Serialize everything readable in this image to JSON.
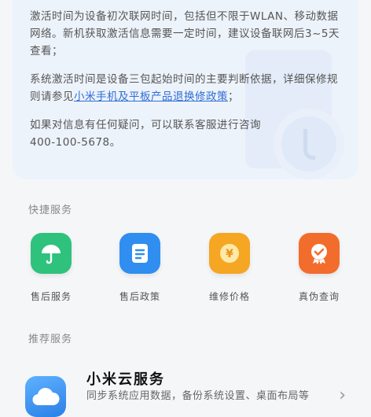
{
  "info": {
    "para1": "激活时间为设备初次联网时间，包括但不限于WLAN、移动数据网络。新机获取激活信息需要一定时间，建议设备联网后3~5天查看；",
    "para2_prefix": "系统激活时间是设备三包起始时间的主要判断依据，详细保修规则请参见",
    "para2_link": "小米手机及平板产品退换修政策",
    "para2_suffix": "；",
    "para3_line1": "如果对信息有任何疑问，可以联系客服进行咨询",
    "para3_line2": "400-100-5678。"
  },
  "quick_services": {
    "title": "快捷服务",
    "items": [
      {
        "label": "售后服务",
        "icon": "umbrella-icon",
        "color": "#2fc27d"
      },
      {
        "label": "售后政策",
        "icon": "document-icon",
        "color": "#2f8ef0"
      },
      {
        "label": "维修价格",
        "icon": "yen-coin-icon",
        "color": "#f5a623"
      },
      {
        "label": "真伪查询",
        "icon": "badge-check-icon",
        "color": "#f26d2b"
      }
    ]
  },
  "recommended": {
    "title": "推荐服务",
    "app_title": "小米云服务",
    "app_desc": "同步系统应用数据，备份系统设置、桌面布局等",
    "icon": "cloud-icon"
  }
}
